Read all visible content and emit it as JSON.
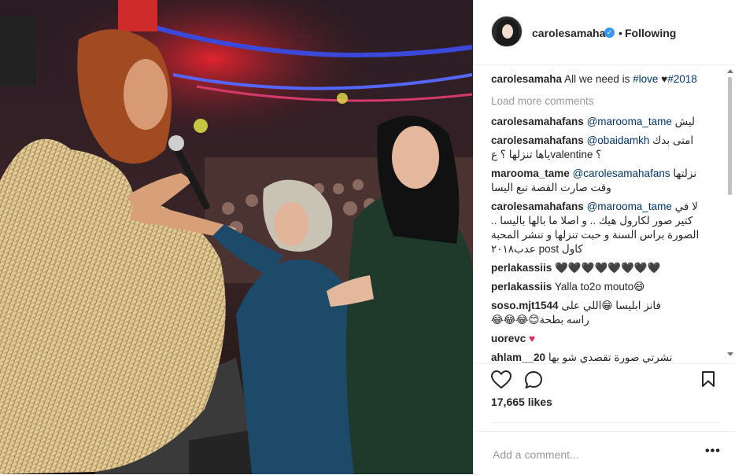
{
  "post": {
    "username": "carolesamaha",
    "follow_status": "Following",
    "separator": "•",
    "likes": "17,665 likes"
  },
  "caption": {
    "user": "carolesamaha",
    "text_before": " All we need is ",
    "tag1": "#love",
    "text_mid": " ♥",
    "tag2": "#2018"
  },
  "load_more": "Load more comments",
  "comments": [
    {
      "user": "carolesamahafans",
      "mention": "@marooma_tame",
      "text": " ليش"
    },
    {
      "user": "carolesamahafans",
      "mention": "@obaidamkh",
      "text": " امتى بدك",
      "line2": "؟ valentineياها تنزلها ؟ ع"
    },
    {
      "user": "marooma_tame",
      "mention": "@carolesamahafans",
      "text": " نزلتها",
      "line2": "وقت صارت القصة تبع اليسا"
    },
    {
      "user": "carolesamahafans",
      "mention": "@marooma_tame",
      "text": " لا في",
      "line2": "كتير صور لكارول هيك .. و اصلا ما بالها باليسا ..",
      "line3": "الصورة براس السنة و حبت تنزلها و تنشر المحبة",
      "line4": "كاول post عدب٢٠١٨"
    },
    {
      "user": "perlakassiis",
      "text": " 🖤🖤🖤🖤🖤🖤🖤🖤"
    },
    {
      "user": "perlakassiis",
      "text": " Yalla to2o mouto😄"
    },
    {
      "user": "soso.mjt1544",
      "text": " فانز ابليسا 😁اللي على",
      "line2": "راسه بطحة😊😂😂😂"
    },
    {
      "user": "uorevc",
      "text": "♥"
    },
    {
      "user": "ahlam__20",
      "text": " نشرتي صورة تقصدي شو بها"
    }
  ],
  "add_comment": {
    "placeholder": "Add a comment..."
  },
  "icons": {
    "like": "heart-icon",
    "comment": "comment-icon",
    "save": "bookmark-icon",
    "more": "more-options-icon",
    "verified": "verified-badge-icon"
  },
  "colors": {
    "link": "#003569",
    "verified": "#3897f0",
    "muted": "#999999",
    "text": "#262626"
  }
}
